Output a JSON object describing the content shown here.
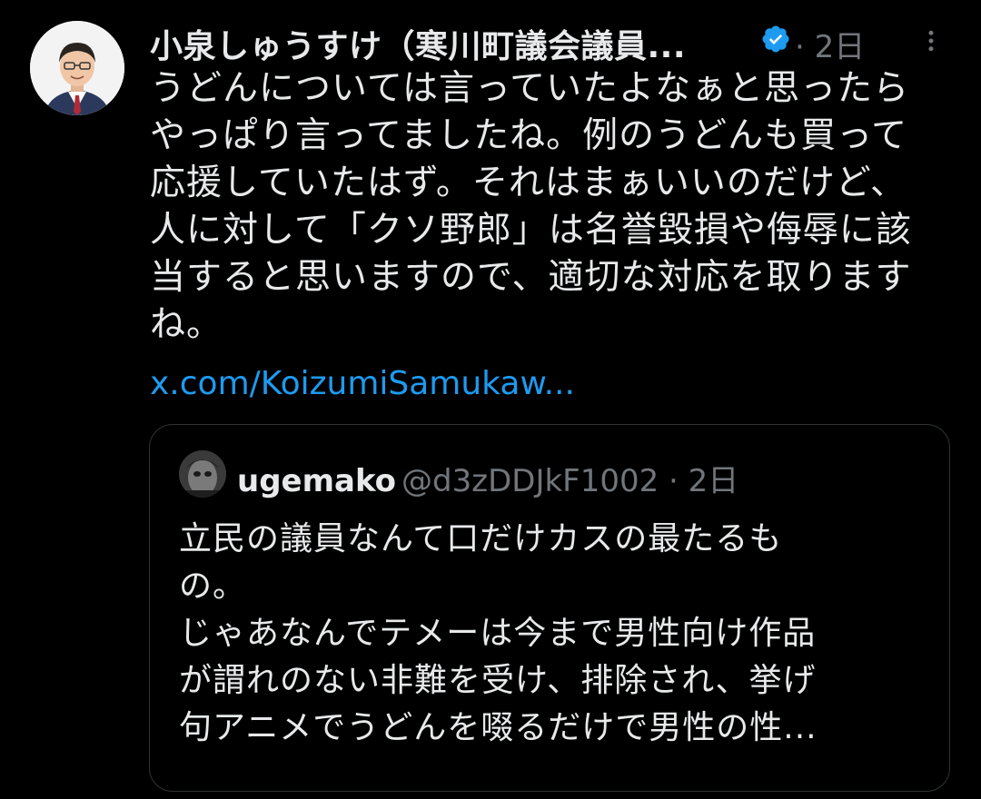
{
  "tweet": {
    "author": {
      "display_name": "小泉しゅうすけ（寒川町議会議員...",
      "verified_icon": "verified-badge-icon",
      "timestamp": "· 2日"
    },
    "more_icon": "more-vertical-icon",
    "text": "うどんについては言っていたよなぁと思ったら\nやっぱり言ってましたね。例のうどんも買って\n応援していたはず。それはまぁいいのだけど、\n人に対して「クソ野郎」は名誉毀損や侮辱に該\n当すると思いますので、適切な対応を取ります\nね。",
    "link": "x.com/KoizumiSamukaw...",
    "quoted": {
      "display_name": "ugemako",
      "handle_time": "@d3zDDJkF1002 · 2日",
      "text": "立民の議員なんて口だけカスの最たるも\nの。\nじゃあなんでテメーは今まで男性向け作品\nが謂れのない非難を受け、排除され、挙げ\n句アニメでうどんを啜るだけで男性の性..."
    }
  },
  "colors": {
    "background": "#000000",
    "text": "#e7e9ea",
    "secondary": "#71767b",
    "link": "#1d9bf0",
    "border": "#2f3336"
  }
}
